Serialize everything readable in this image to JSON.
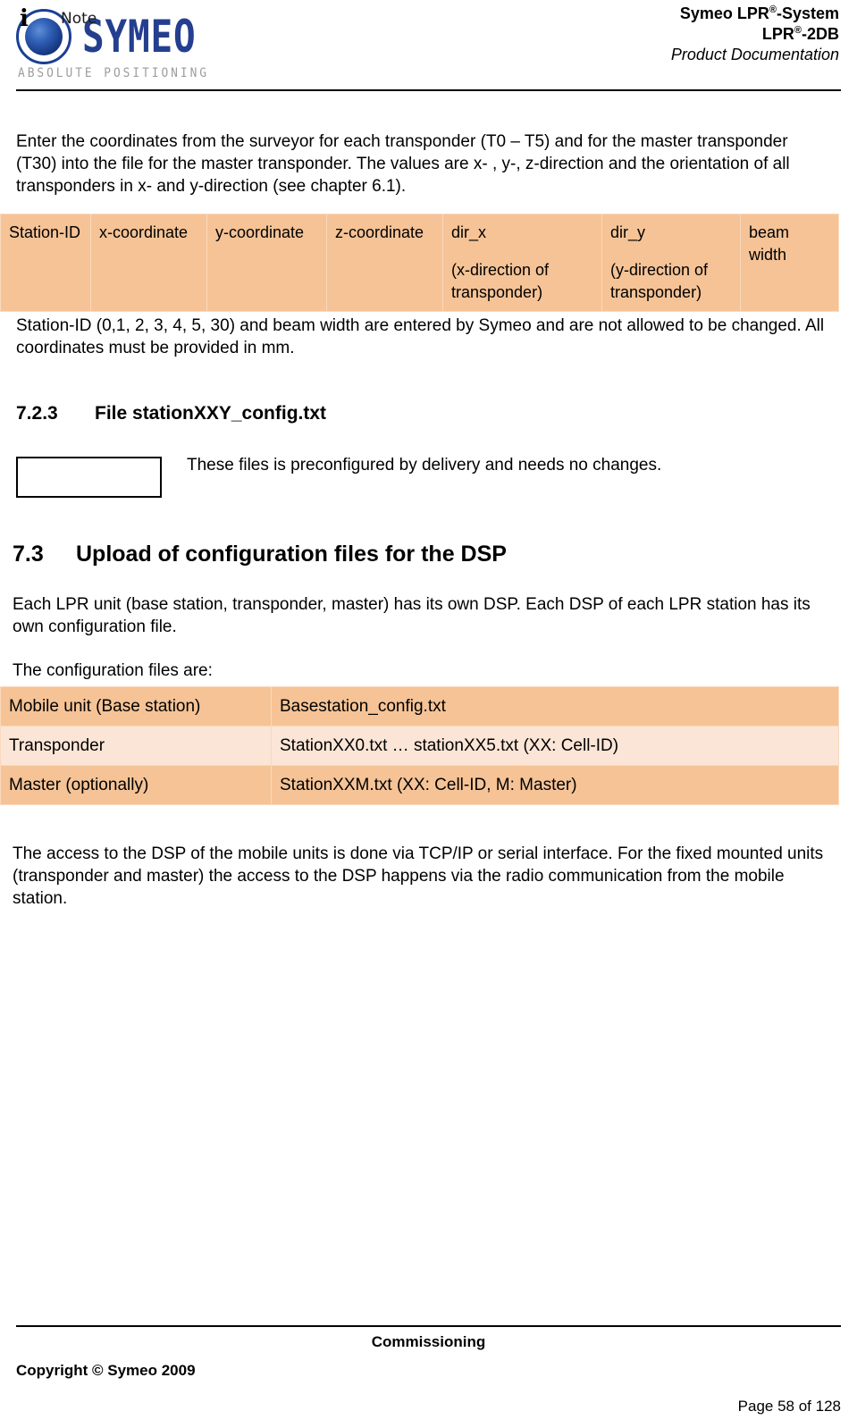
{
  "header": {
    "logo": {
      "wordmark": "SYMEO",
      "tagline": "ABSOLUTE POSITIONING"
    },
    "title_line1_pre": "Symeo LPR",
    "title_line1_sup": "®",
    "title_line1_post": "-System",
    "title_line2_pre": "LPR",
    "title_line2_sup": "®",
    "title_line2_post": "-2DB",
    "subtitle": "Product Documentation"
  },
  "intro_paragraph": "Enter the coordinates from the surveyor for each transponder (T0 – T5) and for the master transponder (T30) into the file for the master transponder. The values are x- , y-, z-direction and the orientation of all transponders in x- and y-direction (see chapter 6.1).",
  "coordinate_table": {
    "columns": [
      {
        "title": "Station-ID",
        "sub": ""
      },
      {
        "title": "x-coordinate",
        "sub": ""
      },
      {
        "title": "y-coordinate",
        "sub": ""
      },
      {
        "title": "z-coordinate",
        "sub": ""
      },
      {
        "title": "dir_x",
        "sub": "(x-direction of transponder)"
      },
      {
        "title": "dir_y",
        "sub": "(y-direction of transponder)"
      },
      {
        "title": "beam width",
        "sub": ""
      }
    ]
  },
  "after_table_paragraph": "Station-ID (0,1, 2, 3, 4, 5, 30) and beam width are entered by Symeo and are not allowed to be changed. All coordinates must be provided in mm.",
  "section_723": {
    "number": "7.2.3",
    "title": "File stationXXY_config.txt"
  },
  "note": {
    "icon_label": "i",
    "label": "Note",
    "text": "These files is preconfigured by delivery and needs no changes."
  },
  "section_73": {
    "number": "7.3",
    "title": "Upload of configuration files for the DSP"
  },
  "dsp_paragraph": "Each LPR unit (base station, transponder, master) has its own DSP. Each DSP of each LPR station has its own configuration file.",
  "config_files_lead": "The configuration files are:",
  "config_table": {
    "rows": [
      {
        "unit": "Mobile unit (Base station)",
        "file": "Basestation_config.txt"
      },
      {
        "unit": "Transponder",
        "file": "StationXX0.txt … stationXX5.txt (XX: Cell-ID)"
      },
      {
        "unit": "Master (optionally)",
        "file": "StationXXM.txt (XX: Cell-ID, M: Master)"
      }
    ]
  },
  "access_paragraph": "The access to the DSP of the mobile units is done via TCP/IP or serial interface. For the fixed mounted units (transponder and master) the access to the DSP happens via the radio communication from the mobile station.",
  "footer": {
    "center": "Commissioning",
    "copyright": "Copyright © Symeo 2009",
    "page": "Page 58 of 128"
  },
  "colors": {
    "table_header_orange": "#F5C396",
    "table_row_light": "#FBE5D6",
    "logo_blue": "#243F8F",
    "logo_tagline_gray": "#9D9D9D"
  }
}
